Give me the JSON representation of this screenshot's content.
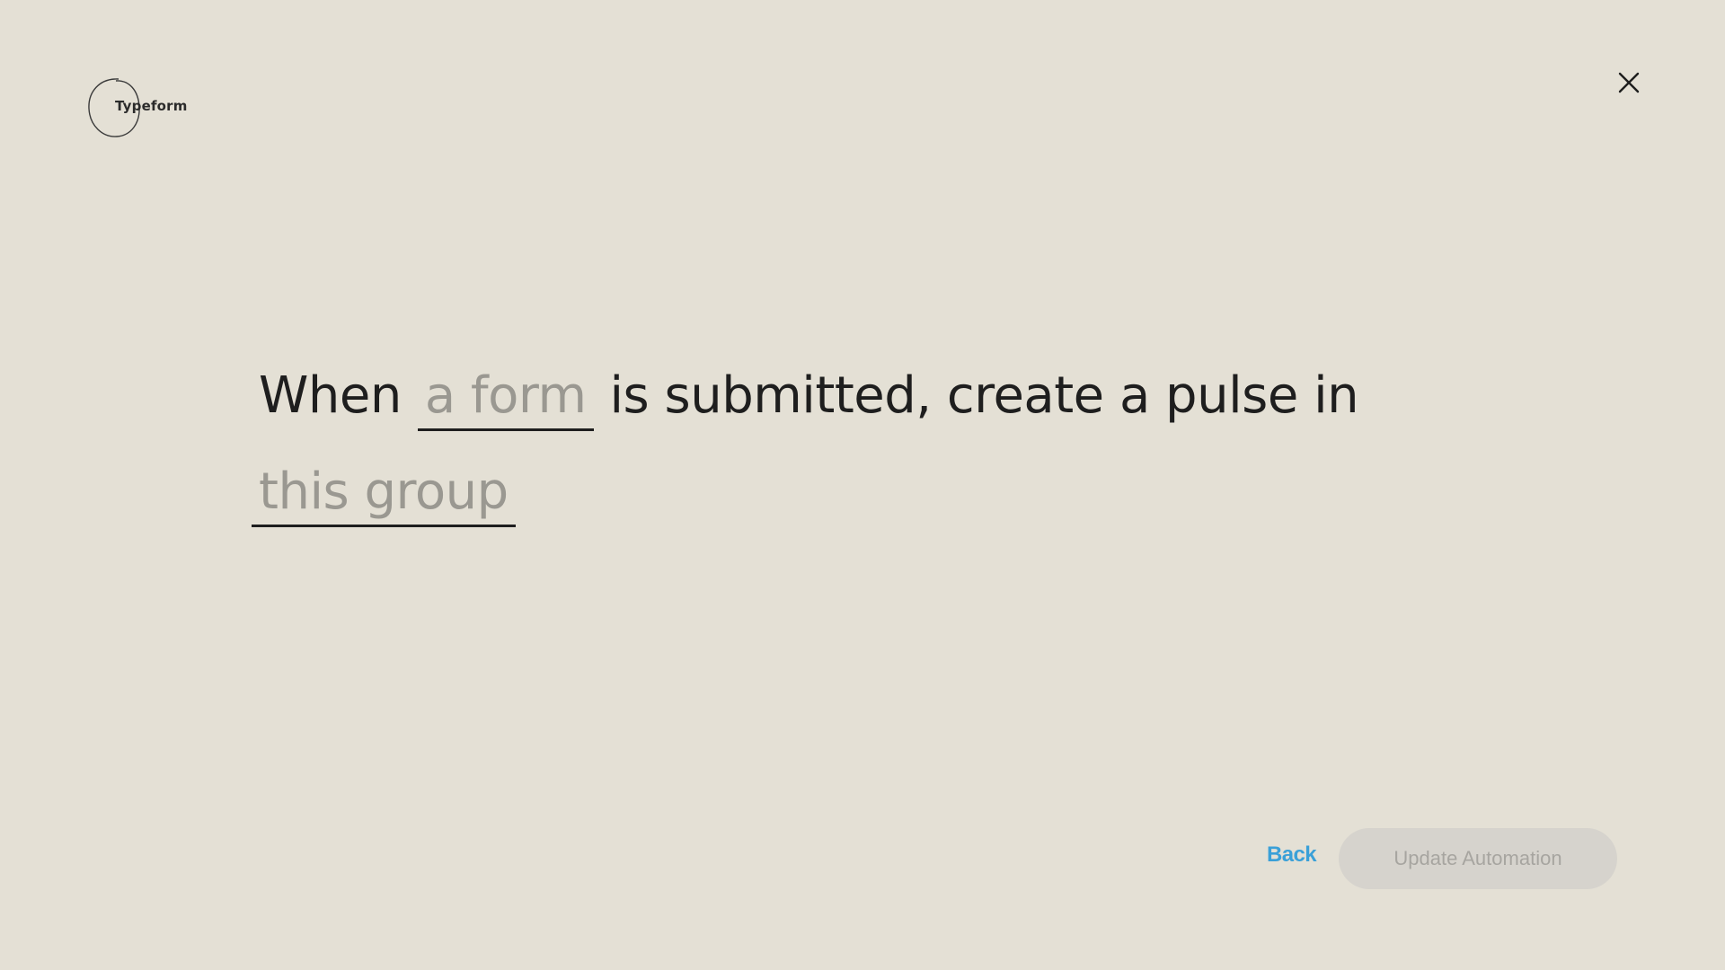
{
  "header": {
    "logo_text": "Typeform",
    "close_icon": "close-icon"
  },
  "sentence": {
    "word_when": "When",
    "slot_form": "a form",
    "phrase_after_form": "is submitted, create a pulse in",
    "slot_group": "this group"
  },
  "footer": {
    "back_label": "Back",
    "update_label": "Update Automation"
  },
  "colors": {
    "background": "#e4e0d5",
    "accent_link": "#3aa0d8",
    "placeholder": "#9a9891",
    "button_disabled_bg": "#d6d3cd"
  }
}
